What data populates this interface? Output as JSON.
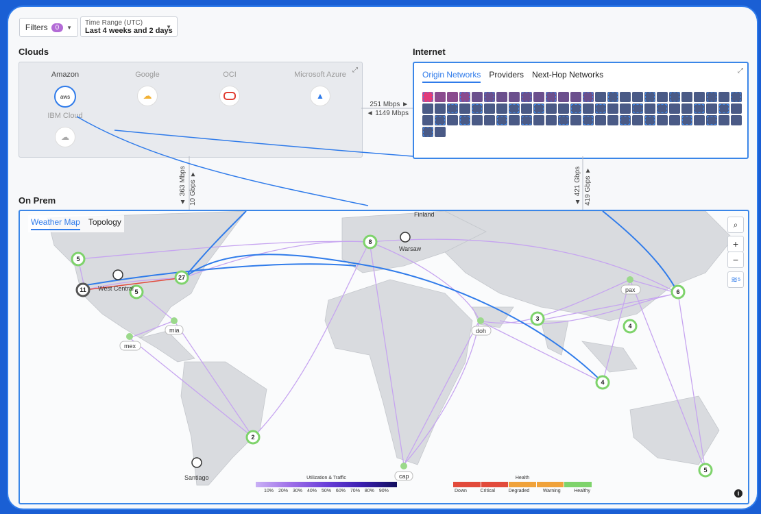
{
  "toolbar": {
    "filters_label": "Filters",
    "filters_count": "0",
    "time_range_label": "Time Range (UTC)",
    "time_range_value": "Last 4 weeks and 2 days"
  },
  "clouds": {
    "title": "Clouds",
    "providers": [
      "Amazon",
      "Google",
      "OCI",
      "Microsoft Azure",
      "IBM Cloud"
    ],
    "aws_icon_text": "aws"
  },
  "internet": {
    "title": "Internet",
    "tabs": [
      "Origin Networks",
      "Providers",
      "Next-Hop Networks"
    ],
    "traffic_out": "251 Mbps ►",
    "traffic_in": "◄ 1149 Mbps"
  },
  "links": {
    "clouds_onprem_up": "▲ 363 Mbps",
    "clouds_onprem_down": "10 Gbps ▼",
    "internet_onprem_up": "▲ 421 Gbps",
    "internet_onprem_down": "419 Gbps ▼"
  },
  "onprem": {
    "title": "On Prem",
    "tabs": [
      "Weather Map",
      "Topology"
    ],
    "layer_count": "5",
    "place_labels": {
      "finland": "Finland",
      "warsaw": "Warsaw",
      "west_central": "West Central",
      "santiago": "Santiago",
      "mia": "mia",
      "mex": "mex",
      "doh": "doh",
      "pax": "pax",
      "cap": "cap"
    },
    "nodes": {
      "n5a": "5",
      "n11": "11",
      "n5b": "5",
      "n27": "27",
      "n8": "8",
      "n6": "6",
      "n3": "3",
      "n4a": "4",
      "n4b": "4",
      "n2": "2",
      "n5c": "5"
    }
  },
  "legend": {
    "utilization_title": "Utilization & Traffic",
    "utilization_ticks": [
      "10%",
      "20%",
      "30%",
      "40%",
      "50%",
      "60%",
      "70%",
      "80%",
      "90%"
    ],
    "health_title": "Health",
    "health_states": [
      "Down",
      "Critical",
      "Degraded",
      "Warning",
      "Healthy"
    ],
    "health_colors": [
      "#e24a3b",
      "#e24a3b",
      "#f0a23a",
      "#f0a23a",
      "#7ed36b"
    ]
  }
}
